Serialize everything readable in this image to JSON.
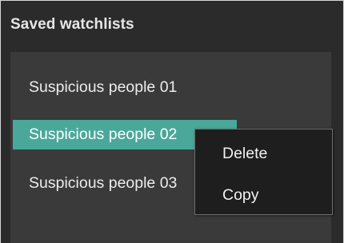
{
  "panel": {
    "title": "Saved watchlists"
  },
  "watchlists": {
    "items": [
      {
        "label": "Suspicious people 01",
        "selected": false
      },
      {
        "label": "Suspicious people 02",
        "selected": true
      },
      {
        "label": "Suspicious people 03",
        "selected": false
      }
    ]
  },
  "context_menu": {
    "items": [
      {
        "label": "Delete"
      },
      {
        "label": "Copy"
      }
    ]
  },
  "colors": {
    "background": "#2b2b2b",
    "list_background": "#3a3a3a",
    "selection": "#4aa89a",
    "menu_background": "#1e1e1e",
    "menu_border": "#6e6e6e",
    "text": "#ececec"
  }
}
